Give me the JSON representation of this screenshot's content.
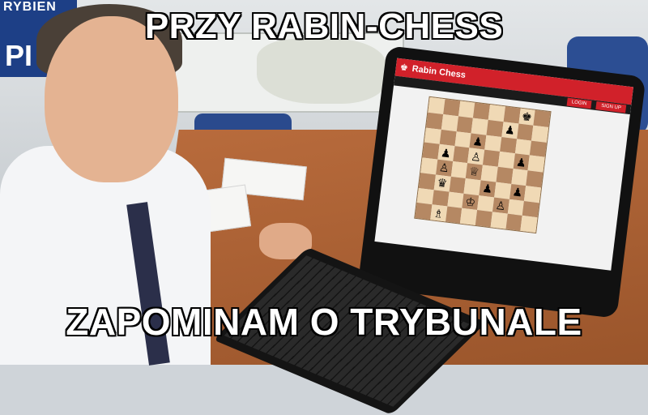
{
  "meme": {
    "top_text": "PRZY RABIN-CHESS",
    "bottom_text": "ZAPOMINAM O TRYBUNALE"
  },
  "background": {
    "banner_text": "RYBIEN",
    "banner_big": "PI"
  },
  "app": {
    "title": "Rabin Chess",
    "logo_icon": "chess-king-icon",
    "login_label": "LOGIN",
    "signup_label": "SIGN UP",
    "accent_color": "#d1212a"
  },
  "board": {
    "rows": [
      [
        "",
        "",
        "",
        "",
        "",
        "",
        "♚",
        ""
      ],
      [
        "",
        "",
        "",
        "",
        "",
        "♟",
        "",
        ""
      ],
      [
        "",
        "",
        "",
        "♟",
        "",
        "",
        "",
        ""
      ],
      [
        "",
        "♟",
        "",
        "♙",
        "",
        "",
        "♟",
        ""
      ],
      [
        "",
        "♙",
        "",
        "♕",
        "",
        "",
        "",
        ""
      ],
      [
        "",
        "♛",
        "",
        "",
        "♟",
        "",
        "♟",
        ""
      ],
      [
        "",
        "",
        "",
        "♔",
        "",
        "♙",
        "",
        ""
      ],
      [
        "",
        "♗",
        "",
        "",
        "",
        "",
        "",
        ""
      ]
    ]
  }
}
